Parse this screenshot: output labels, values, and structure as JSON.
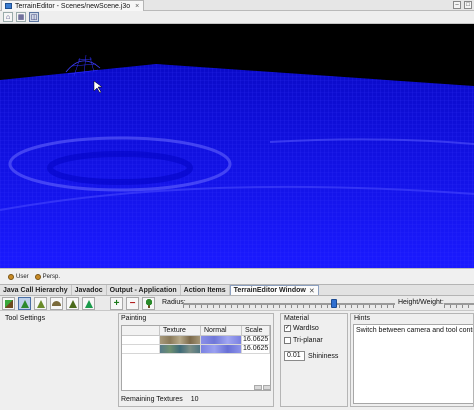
{
  "window": {
    "title_tab": "TerrainEditor - Scenes/newScene.j3o"
  },
  "viewport": {
    "background": "#000000",
    "wire_color": "#1212ff"
  },
  "cameras": [
    {
      "label": "User"
    },
    {
      "label": "Persp."
    }
  ],
  "panel_tabs": [
    {
      "label": "Java Call Hierarchy"
    },
    {
      "label": "Javadoc"
    },
    {
      "label": "Output - Application"
    },
    {
      "label": "Action Items"
    },
    {
      "label": "TerrainEditor Window",
      "close": "✕",
      "active": true
    }
  ],
  "tools": {
    "radius_label": "Radius:",
    "radius_level": 0.72,
    "height_weight_label": "Height/Weight:"
  },
  "tool_settings": {
    "label": "Tool Settings"
  },
  "painting": {
    "label": "Painting",
    "columns": [
      "",
      "Texture",
      "Normal",
      "Scale"
    ],
    "rows": [
      {
        "scale": "16.0625"
      },
      {
        "scale": "16.0625"
      }
    ],
    "remaining_label": "Remaining Textures",
    "remaining_count": "10"
  },
  "material": {
    "label": "Material",
    "wardiso_label": "WardIso",
    "wardiso_checked": "✓",
    "triplanar_label": "Tri-planar",
    "shininess_value": "0.01",
    "shininess_label": "Shininess"
  },
  "hints": {
    "label": "Hints",
    "text": "Switch between camera and tool controls by h"
  }
}
